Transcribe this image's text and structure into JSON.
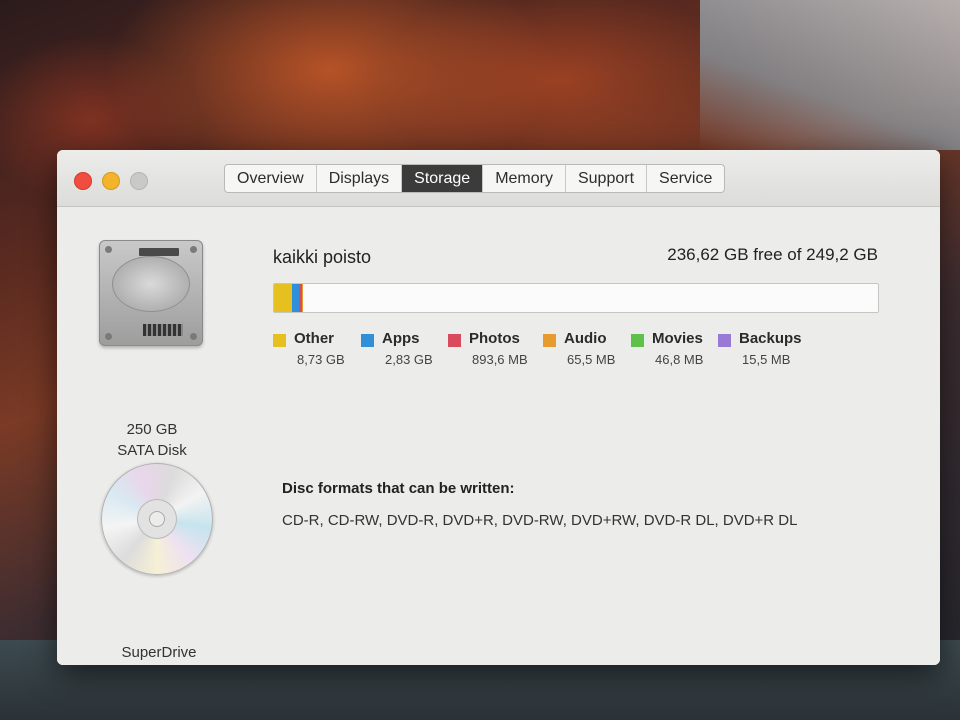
{
  "window": {
    "tabs": [
      {
        "label": "Overview",
        "active": false
      },
      {
        "label": "Displays",
        "active": false
      },
      {
        "label": "Storage",
        "active": true
      },
      {
        "label": "Memory",
        "active": false
      },
      {
        "label": "Support",
        "active": false
      },
      {
        "label": "Service",
        "active": false
      }
    ]
  },
  "disk": {
    "icon": "hard-drive-icon",
    "size_label": "250 GB",
    "type_label": "SATA Disk",
    "name": "kaikki poisto",
    "free_text": "236,62 GB free of 249,2 GB",
    "categories": [
      {
        "name": "Other",
        "size": "8,73 GB",
        "color": "#e6c01e"
      },
      {
        "name": "Apps",
        "size": "2,83 GB",
        "color": "#2f8fd8"
      },
      {
        "name": "Photos",
        "size": "893,6 MB",
        "color": "#d94a5c"
      },
      {
        "name": "Audio",
        "size": "65,5 MB",
        "color": "#e79a2e"
      },
      {
        "name": "Movies",
        "size": "46,8 MB",
        "color": "#5fc04a"
      },
      {
        "name": "Backups",
        "size": "15,5 MB",
        "color": "#9a79d6"
      }
    ]
  },
  "drive": {
    "icon": "optical-disc-icon",
    "name": "SuperDrive",
    "formats_title": "Disc formats that can be written:",
    "formats": "CD-R, CD-RW, DVD-R, DVD+R, DVD-RW, DVD+RW, DVD-R DL, DVD+R DL"
  }
}
